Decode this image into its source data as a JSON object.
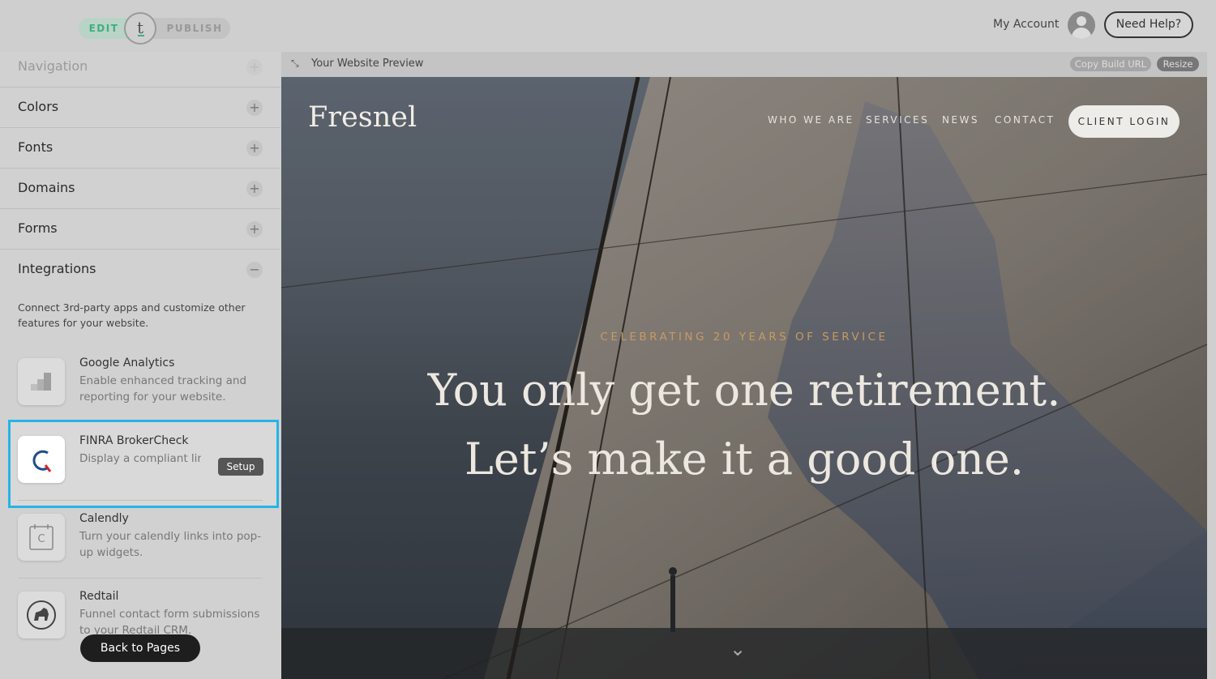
{
  "topbar": {
    "mode_edit": "EDIT",
    "mode_logo": "t",
    "mode_publish": "PUBLISH",
    "my_account": "My Account",
    "need_help": "Need Help?"
  },
  "sidebar": {
    "sections": [
      {
        "label": "Navigation",
        "toggle": "+"
      },
      {
        "label": "Colors",
        "toggle": "+"
      },
      {
        "label": "Fonts",
        "toggle": "+"
      },
      {
        "label": "Domains",
        "toggle": "+"
      },
      {
        "label": "Forms",
        "toggle": "+"
      },
      {
        "label": "Integrations",
        "toggle": "−"
      }
    ],
    "integrations_description": "Connect 3rd-party apps and customize other features for your website.",
    "integrations": [
      {
        "name": "Google Analytics",
        "description": "Enable enhanced tracking and reporting for your website.",
        "icon": "bar-chart-icon"
      },
      {
        "name": "FINRA BrokerCheck",
        "description": "Display a compliant link BrokerCheck page.",
        "icon": "finra-logo-icon",
        "action": "Setup"
      },
      {
        "name": "Calendly",
        "description": "Turn your calendly links into pop-up widgets.",
        "icon": "calendar-icon",
        "icon_letter": "C"
      },
      {
        "name": "Redtail",
        "description": "Funnel contact form submissions to your Redtail CRM.",
        "icon": "redtail-dog-icon"
      }
    ],
    "back_to_pages": "Back to Pages"
  },
  "preview": {
    "expand_glyph": "⤡",
    "title": "Your Website Preview",
    "copy_build_url": "Copy Build URL",
    "resize": "Resize"
  },
  "site": {
    "brand": "Fresnel",
    "nav": [
      "WHO WE ARE",
      "SERVICES",
      "NEWS",
      "CONTACT"
    ],
    "client_login": "CLIENT LOGIN",
    "eyebrow": "CELEBRATING 20 YEARS OF SERVICE",
    "headline_line1": "You only get one retirement.",
    "headline_line2": "Let’s make it a good one.",
    "scroll_glyph": "⌄"
  },
  "colors": {
    "edit_green": "#3fae82",
    "highlight_blue": "#25b5e6",
    "eyebrow_gold": "#c79a62"
  }
}
